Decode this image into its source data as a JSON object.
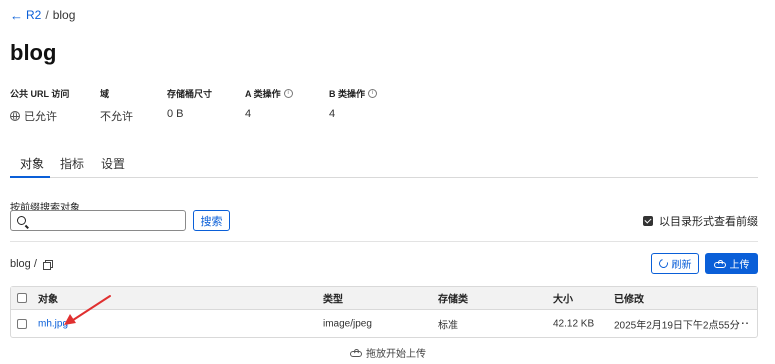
{
  "breadcrumb": {
    "back_label": "R2",
    "current": "blog",
    "separator": "/"
  },
  "page_title": "blog",
  "stats": [
    {
      "label": "公共 URL 访问",
      "value": "已允许",
      "icon": "globe-icon"
    },
    {
      "label": "域",
      "value": "不允许"
    },
    {
      "label": "存储桶尺寸",
      "value": "0 B"
    },
    {
      "label": "A 类操作",
      "value": "4",
      "info": "ⓘ"
    },
    {
      "label": "B 类操作",
      "value": "4",
      "info": "ⓘ"
    }
  ],
  "tabs": [
    "对象",
    "指标",
    "设置"
  ],
  "search": {
    "label": "按前缀搜索对象",
    "value": "",
    "placeholder": "",
    "button": "搜索"
  },
  "dir_toggle": {
    "label": "以目录形式查看前缀",
    "checked": true
  },
  "path": "blog /",
  "actions": {
    "refresh": "刷新",
    "upload": "上传"
  },
  "table": {
    "headers": [
      "对象",
      "类型",
      "存储类",
      "大小",
      "已修改"
    ],
    "rows": [
      {
        "name": "mh.jpg",
        "type": "image/jpeg",
        "storage": "标准",
        "size": "42.12 KB",
        "modified": "2025年2月19日下午2点55分",
        "menu": "···"
      }
    ]
  },
  "drop_hint": "拖放开始上传",
  "colors": {
    "accent": "#0a5fd8",
    "annotation": "#e03030"
  }
}
